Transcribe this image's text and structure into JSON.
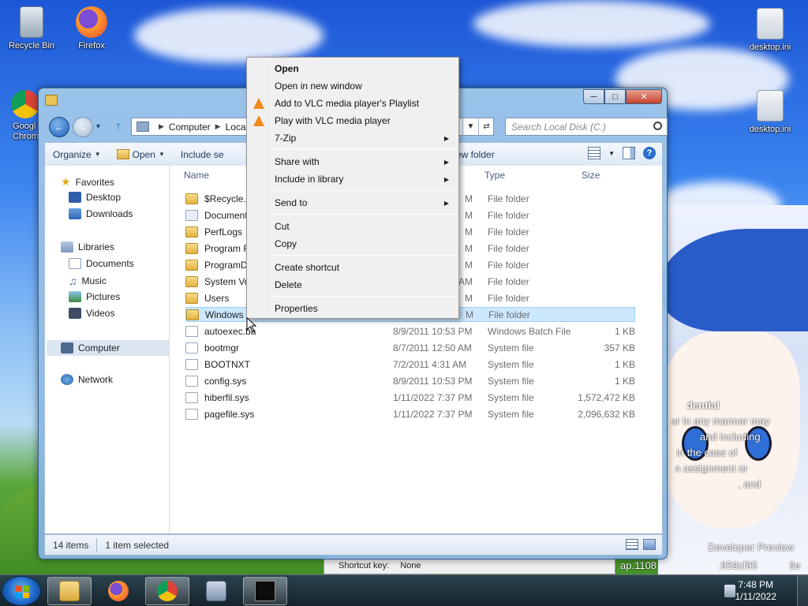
{
  "desktop": {
    "icons": [
      {
        "label": "Recycle Bin",
        "icon": "recycle-bin-icon"
      },
      {
        "label": "Firefox",
        "icon": "firefox-icon"
      },
      {
        "label": "Googl\nChrom",
        "icon": "chrome-icon"
      },
      {
        "label": "desktop.ini",
        "icon": "settings-file-icon"
      },
      {
        "label": "desktop.ini",
        "icon": "settings-file-icon"
      }
    ],
    "overlay_lines": [
      "dential",
      "ur in any manner may",
      "and including",
      "in the case of",
      "n assignment or",
      ", and",
      "Developer Preview",
      "ap.1108",
      ".959cf95",
      "6e"
    ]
  },
  "window": {
    "address": {
      "crumbs": [
        "Computer",
        "Local"
      ]
    },
    "search": {
      "placeholder": "Search Local Disk (C:)"
    },
    "toolbar": {
      "organize": "Organize",
      "open": "Open",
      "include": "Include se",
      "new_folder": "ew folder"
    },
    "nav": {
      "favorites": "Favorites",
      "desktop": "Desktop",
      "downloads": "Downloads",
      "libraries": "Libraries",
      "documents": "Documents",
      "music": "Music",
      "pictures": "Pictures",
      "videos": "Videos",
      "computer": "Computer",
      "network": "Network"
    },
    "columns": {
      "name": "Name",
      "type": "Type",
      "size": "Size"
    },
    "rows": [
      {
        "name": "$Recycle.Bi",
        "date": "M",
        "type": "File folder",
        "size": "",
        "kind": "folder"
      },
      {
        "name": "Documents",
        "date": "M",
        "type": "File folder",
        "size": "",
        "kind": "shortcut"
      },
      {
        "name": "PerfLogs",
        "date": "M",
        "type": "File folder",
        "size": "",
        "kind": "folder"
      },
      {
        "name": "Program Fi",
        "date": "M",
        "type": "File folder",
        "size": "",
        "kind": "folder"
      },
      {
        "name": "ProgramDa",
        "date": "M",
        "type": "File folder",
        "size": "",
        "kind": "folder"
      },
      {
        "name": "System Vol",
        "date": "AM",
        "type": "File folder",
        "size": "",
        "kind": "folder"
      },
      {
        "name": "Users",
        "date": "M",
        "type": "File folder",
        "size": "",
        "kind": "folder"
      },
      {
        "name": "Windows",
        "date": "M",
        "type": "File folder",
        "size": "",
        "kind": "folder"
      },
      {
        "name": "autoexec.ba",
        "date": "8/9/2011 10:53 PM",
        "type": "Windows Batch File",
        "size": "1 KB",
        "kind": "file"
      },
      {
        "name": "bootmgr",
        "date": "8/7/2011 12:50 AM",
        "type": "System file",
        "size": "357 KB",
        "kind": "file"
      },
      {
        "name": "BOOTNXT",
        "date": "7/2/2011 4:31 AM",
        "type": "System file",
        "size": "1 KB",
        "kind": "file"
      },
      {
        "name": "config.sys",
        "date": "8/9/2011 10:53 PM",
        "type": "System file",
        "size": "1 KB",
        "kind": "file"
      },
      {
        "name": "hiberfil.sys",
        "date": "1/11/2022 7:37 PM",
        "type": "System file",
        "size": "1,572,472 KB",
        "kind": "file"
      },
      {
        "name": "pagefile.sys",
        "date": "1/11/2022 7:37 PM",
        "type": "System file",
        "size": "2,096,632 KB",
        "kind": "file"
      }
    ],
    "status": {
      "count": "14 items",
      "selected": "1 item selected"
    }
  },
  "context_menu": {
    "open": "Open",
    "open_new": "Open in new window",
    "vlc_playlist": "Add to VLC media player's Playlist",
    "vlc_play": "Play with VLC media player",
    "zip": "7-Zip",
    "share": "Share with",
    "library": "Include in library",
    "send": "Send to",
    "cut": "Cut",
    "copy": "Copy",
    "shortcut": "Create shortcut",
    "delete": "Delete",
    "properties": "Properties"
  },
  "background_dialog": {
    "shortcut_key_label": "Shortcut key:",
    "shortcut_key_value": "None"
  },
  "taskbar": {
    "time": "7:48 PM",
    "date": "1/11/2022"
  },
  "colors": {
    "selection": "#cce8ff",
    "accent": "#1e67c9",
    "folder": "#e2b23f"
  }
}
